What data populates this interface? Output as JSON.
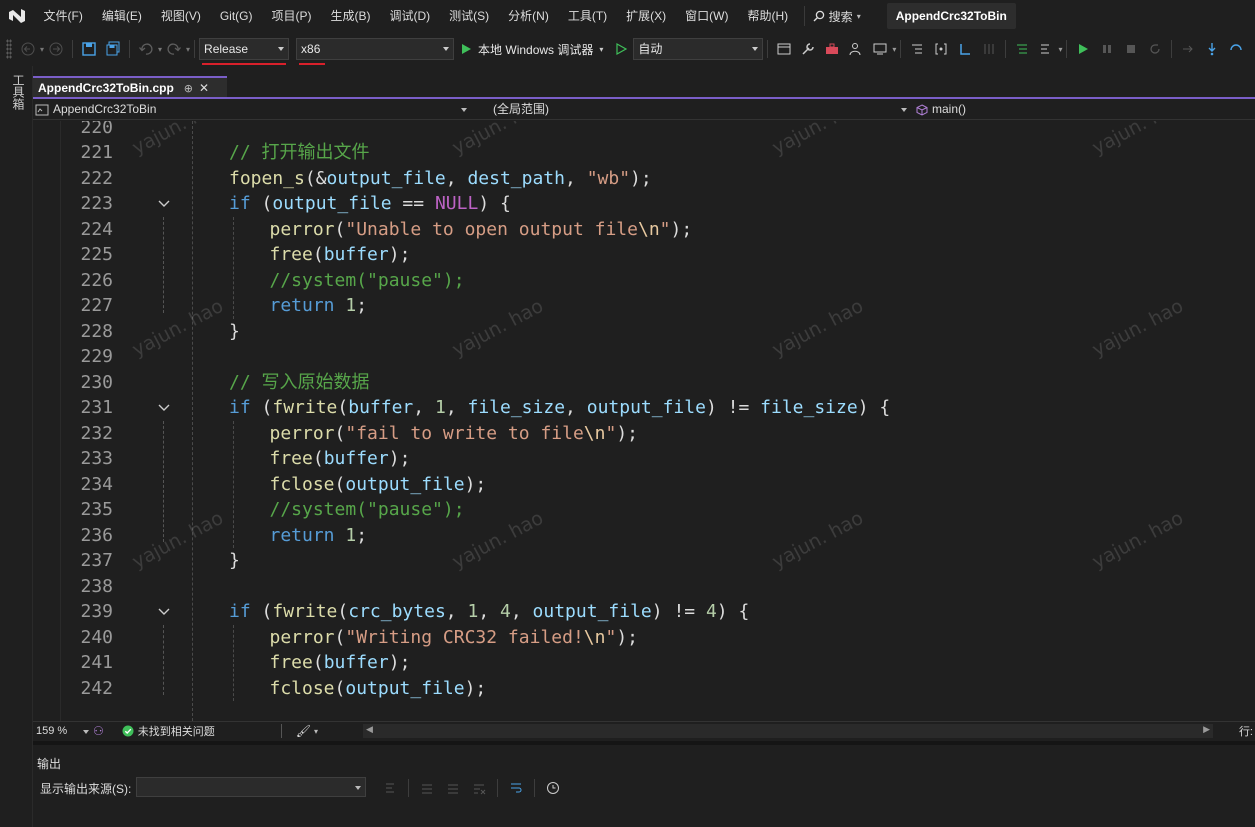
{
  "menubar": {
    "items": [
      "文件(F)",
      "编辑(E)",
      "视图(V)",
      "Git(G)",
      "项目(P)",
      "生成(B)",
      "调试(D)",
      "测试(S)",
      "分析(N)",
      "工具(T)",
      "扩展(X)",
      "窗口(W)",
      "帮助(H)"
    ],
    "search_label": "搜索",
    "project_title": "AppendCrc32ToBin"
  },
  "toolbar": {
    "configuration": "Release",
    "platform": "x86",
    "run_label": "本地 Windows 调试器",
    "run_mode": "自动"
  },
  "leftstrip": {
    "toolbox_label": "工具箱"
  },
  "document_tab": {
    "filename": "AppendCrc32ToBin.cpp"
  },
  "navbar": {
    "project": "AppendCrc32ToBin",
    "scope": "(全局范围)",
    "member": "main()"
  },
  "editor": {
    "watermark": "yajun. hao",
    "lines": [
      {
        "num": "220",
        "tokens": []
      },
      {
        "num": "221",
        "tokens": [
          [
            "com",
            "// 打开输出文件"
          ]
        ]
      },
      {
        "num": "222",
        "tokens": [
          [
            "fn",
            "fopen_s"
          ],
          [
            "plain",
            "(&"
          ],
          [
            "var",
            "output_file"
          ],
          [
            "plain",
            ", "
          ],
          [
            "var",
            "dest_path"
          ],
          [
            "plain",
            ", "
          ],
          [
            "str",
            "\"wb\""
          ],
          [
            "plain",
            ");"
          ]
        ]
      },
      {
        "num": "223",
        "tokens": [
          [
            "kw",
            "if"
          ],
          [
            "plain",
            " ("
          ],
          [
            "var",
            "output_file"
          ],
          [
            "plain",
            " == "
          ],
          [
            "macro",
            "NULL"
          ],
          [
            "plain",
            ") {"
          ]
        ]
      },
      {
        "num": "224",
        "tokens": [
          [
            "fn",
            "perror"
          ],
          [
            "plain",
            "("
          ],
          [
            "str",
            "\"Unable to open output file"
          ],
          [
            "esc",
            "\\n"
          ],
          [
            "str",
            "\""
          ],
          [
            "plain",
            ");"
          ]
        ]
      },
      {
        "num": "225",
        "tokens": [
          [
            "fn",
            "free"
          ],
          [
            "plain",
            "("
          ],
          [
            "var",
            "buffer"
          ],
          [
            "plain",
            ");"
          ]
        ]
      },
      {
        "num": "226",
        "tokens": [
          [
            "com",
            "//system(\"pause\");"
          ]
        ]
      },
      {
        "num": "227",
        "tokens": [
          [
            "kw",
            "return"
          ],
          [
            "plain",
            " "
          ],
          [
            "num",
            "1"
          ],
          [
            "plain",
            ";"
          ]
        ]
      },
      {
        "num": "228",
        "tokens": [
          [
            "plain",
            "}"
          ]
        ]
      },
      {
        "num": "229",
        "tokens": []
      },
      {
        "num": "230",
        "tokens": [
          [
            "com",
            "// 写入原始数据"
          ]
        ]
      },
      {
        "num": "231",
        "tokens": [
          [
            "kw",
            "if"
          ],
          [
            "plain",
            " ("
          ],
          [
            "fn",
            "fwrite"
          ],
          [
            "plain",
            "("
          ],
          [
            "var",
            "buffer"
          ],
          [
            "plain",
            ", "
          ],
          [
            "num",
            "1"
          ],
          [
            "plain",
            ", "
          ],
          [
            "var",
            "file_size"
          ],
          [
            "plain",
            ", "
          ],
          [
            "var",
            "output_file"
          ],
          [
            "plain",
            ") != "
          ],
          [
            "var",
            "file_size"
          ],
          [
            "plain",
            ") {"
          ]
        ]
      },
      {
        "num": "232",
        "tokens": [
          [
            "fn",
            "perror"
          ],
          [
            "plain",
            "("
          ],
          [
            "str",
            "\"fail to write to file"
          ],
          [
            "esc",
            "\\n"
          ],
          [
            "str",
            "\""
          ],
          [
            "plain",
            ");"
          ]
        ]
      },
      {
        "num": "233",
        "tokens": [
          [
            "fn",
            "free"
          ],
          [
            "plain",
            "("
          ],
          [
            "var",
            "buffer"
          ],
          [
            "plain",
            ");"
          ]
        ]
      },
      {
        "num": "234",
        "tokens": [
          [
            "fn",
            "fclose"
          ],
          [
            "plain",
            "("
          ],
          [
            "var",
            "output_file"
          ],
          [
            "plain",
            ");"
          ]
        ]
      },
      {
        "num": "235",
        "tokens": [
          [
            "com",
            "//system(\"pause\");"
          ]
        ]
      },
      {
        "num": "236",
        "tokens": [
          [
            "kw",
            "return"
          ],
          [
            "plain",
            " "
          ],
          [
            "num",
            "1"
          ],
          [
            "plain",
            ";"
          ]
        ]
      },
      {
        "num": "237",
        "tokens": [
          [
            "plain",
            "}"
          ]
        ]
      },
      {
        "num": "238",
        "tokens": []
      },
      {
        "num": "239",
        "tokens": [
          [
            "kw",
            "if"
          ],
          [
            "plain",
            " ("
          ],
          [
            "fn",
            "fwrite"
          ],
          [
            "plain",
            "("
          ],
          [
            "var",
            "crc_bytes"
          ],
          [
            "plain",
            ", "
          ],
          [
            "num",
            "1"
          ],
          [
            "plain",
            ", "
          ],
          [
            "num",
            "4"
          ],
          [
            "plain",
            ", "
          ],
          [
            "var",
            "output_file"
          ],
          [
            "plain",
            ") != "
          ],
          [
            "num",
            "4"
          ],
          [
            "plain",
            ") {"
          ]
        ]
      },
      {
        "num": "240",
        "tokens": [
          [
            "fn",
            "perror"
          ],
          [
            "plain",
            "("
          ],
          [
            "str",
            "\"Writing CRC32 failed!"
          ],
          [
            "esc",
            "\\n"
          ],
          [
            "str",
            "\""
          ],
          [
            "plain",
            ");"
          ]
        ]
      },
      {
        "num": "241",
        "tokens": [
          [
            "fn",
            "free"
          ],
          [
            "plain",
            "("
          ],
          [
            "var",
            "buffer"
          ],
          [
            "plain",
            ");"
          ]
        ]
      },
      {
        "num": "242",
        "tokens": [
          [
            "fn",
            "fclose"
          ],
          [
            "plain",
            "("
          ],
          [
            "var",
            "output_file"
          ],
          [
            "plain",
            ");"
          ]
        ]
      }
    ]
  },
  "status": {
    "zoom": "159 %",
    "issues": "未找到相关问题",
    "position_label": "行:"
  },
  "output": {
    "title": "输出",
    "source_label": "显示输出来源(S):",
    "source_value": ""
  }
}
